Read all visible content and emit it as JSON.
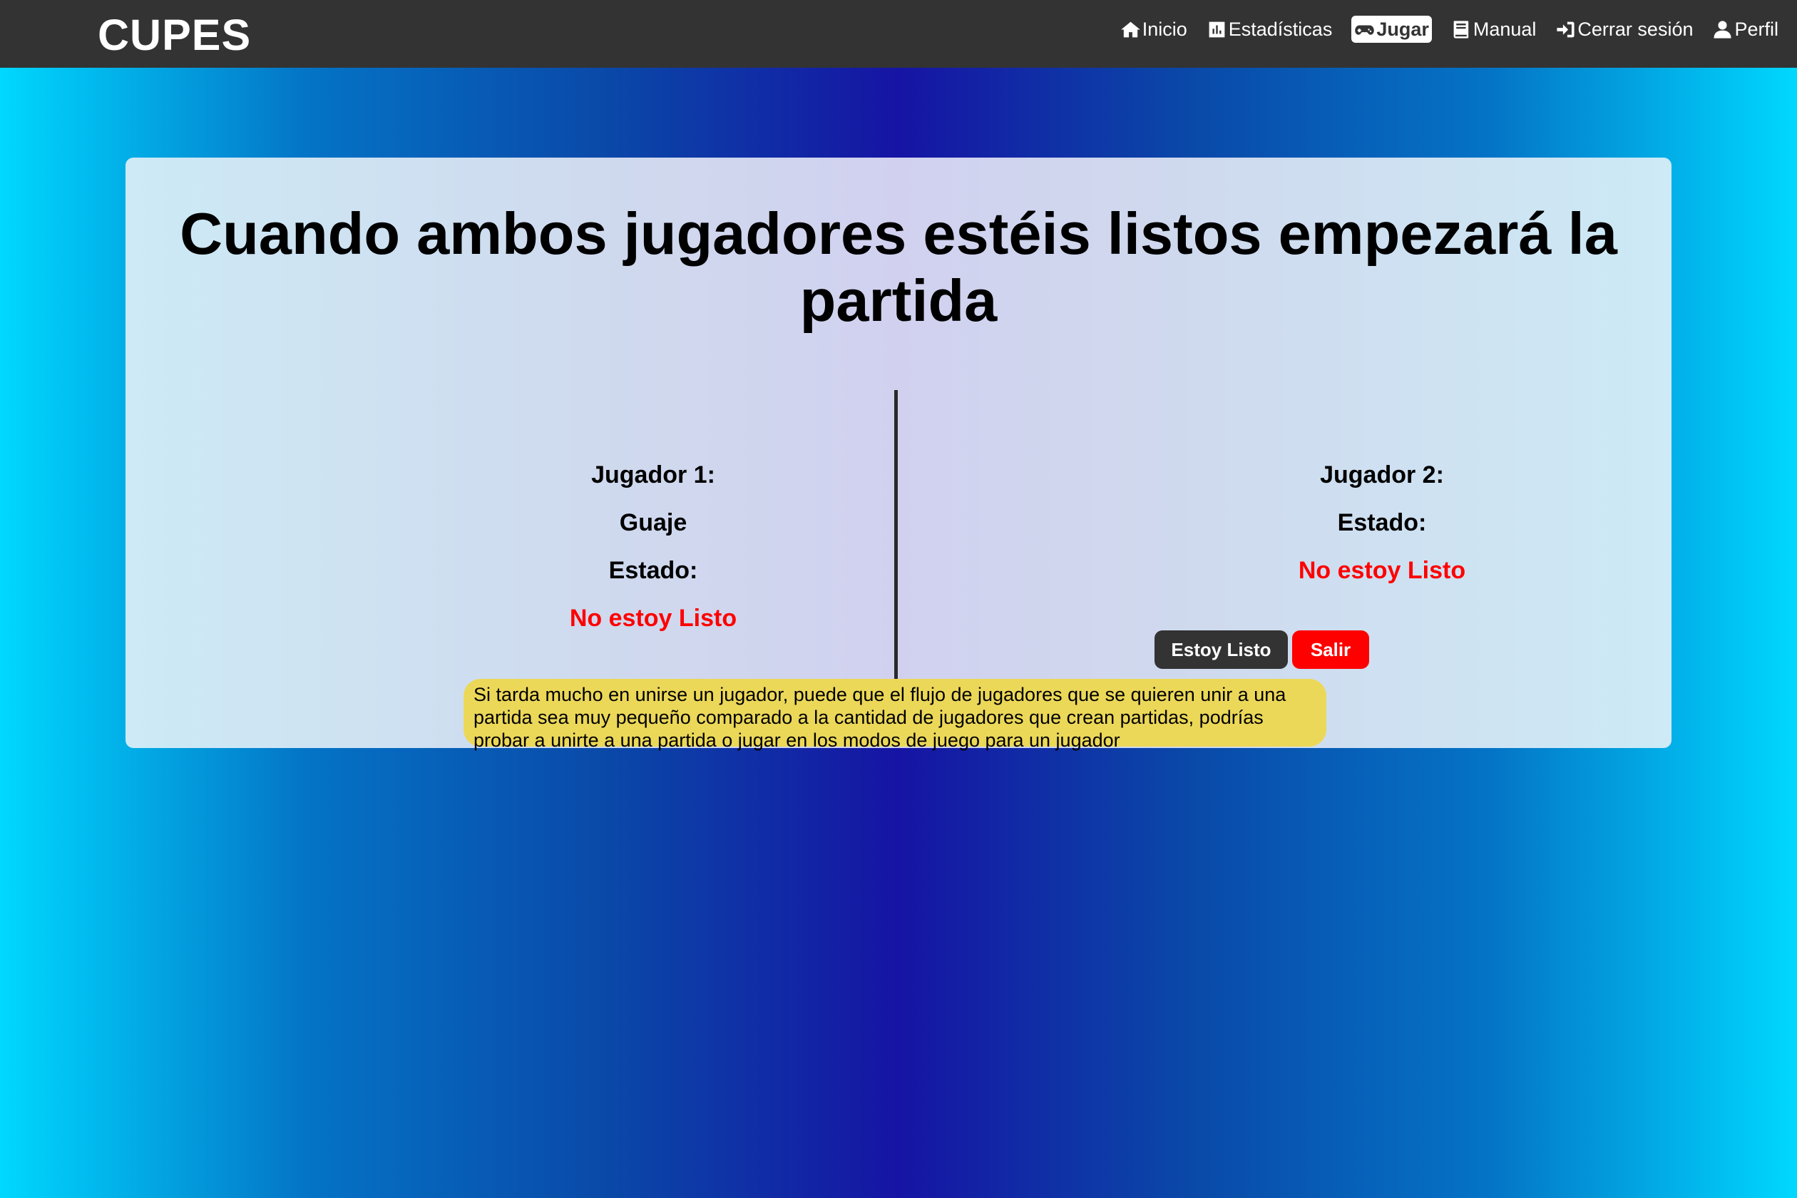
{
  "navbar": {
    "brand": "CUPES",
    "items": [
      {
        "label": "Inicio",
        "icon": "home-icon"
      },
      {
        "label": "Estadísticas",
        "icon": "chart-icon"
      },
      {
        "label": "Jugar",
        "icon": "gamepad-icon",
        "active": true
      },
      {
        "label": "Manual",
        "icon": "book-icon"
      },
      {
        "label": "Cerrar sesión",
        "icon": "logout-icon"
      },
      {
        "label": "Perfil",
        "icon": "user-icon"
      }
    ]
  },
  "main": {
    "title": "Cuando ambos jugadores estéis listos empezará la partida",
    "player1": {
      "heading": "Jugador 1:",
      "name": "Guaje",
      "status_label": "Estado:",
      "status": "No estoy Listo"
    },
    "player2": {
      "heading": "Jugador 2:",
      "status_label": "Estado:",
      "status": "No estoy Listo"
    },
    "buttons": {
      "ready": "Estoy Listo",
      "exit": "Salir"
    },
    "note": "Si tarda mucho en unirse un jugador, puede que el flujo de jugadores que se quieren unir a una partida sea muy pequeño comparado a la cantidad de jugadores que crean partidas, podrías probar a unirte a una partida o jugar en los modos de juego para un jugador"
  },
  "colors": {
    "navbar": "#333333",
    "status_not_ready": "#ff0000",
    "exit_button": "#ff0000",
    "note_background": "#ecd858"
  }
}
